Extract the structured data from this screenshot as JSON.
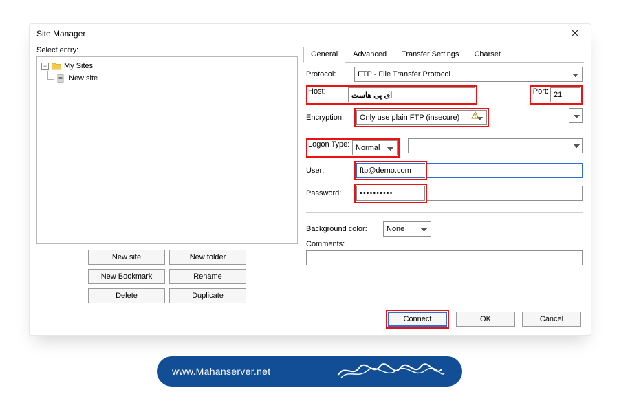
{
  "window": {
    "title": "Site Manager"
  },
  "left": {
    "select_label": "Select entry:",
    "tree": {
      "root": "My Sites",
      "child": "New site"
    },
    "buttons": {
      "new_site": "New site",
      "new_folder": "New folder",
      "new_bookmark": "New Bookmark",
      "rename": "Rename",
      "delete": "Delete",
      "duplicate": "Duplicate"
    }
  },
  "tabs": {
    "general": "General",
    "advanced": "Advanced",
    "transfer": "Transfer Settings",
    "charset": "Charset"
  },
  "form": {
    "protocol_label": "Protocol:",
    "protocol_value": "FTP - File Transfer Protocol",
    "host_label": "Host:",
    "host_value": "آی پی هاست",
    "port_label": "Port:",
    "port_value": "21",
    "encryption_label": "Encryption:",
    "encryption_value": "Only use plain FTP (insecure)",
    "logon_label": "Logon Type:",
    "logon_value": "Normal",
    "user_label": "User:",
    "user_value": "ftp@demo.com",
    "password_label": "Password:",
    "password_value": "••••••••••",
    "bgcolor_label": "Background color:",
    "bgcolor_value": "None",
    "comments_label": "Comments:",
    "comments_value": ""
  },
  "footer": {
    "connect": "Connect",
    "ok": "OK",
    "cancel": "Cancel"
  },
  "banner": {
    "url": "www.Mahanserver.net"
  }
}
